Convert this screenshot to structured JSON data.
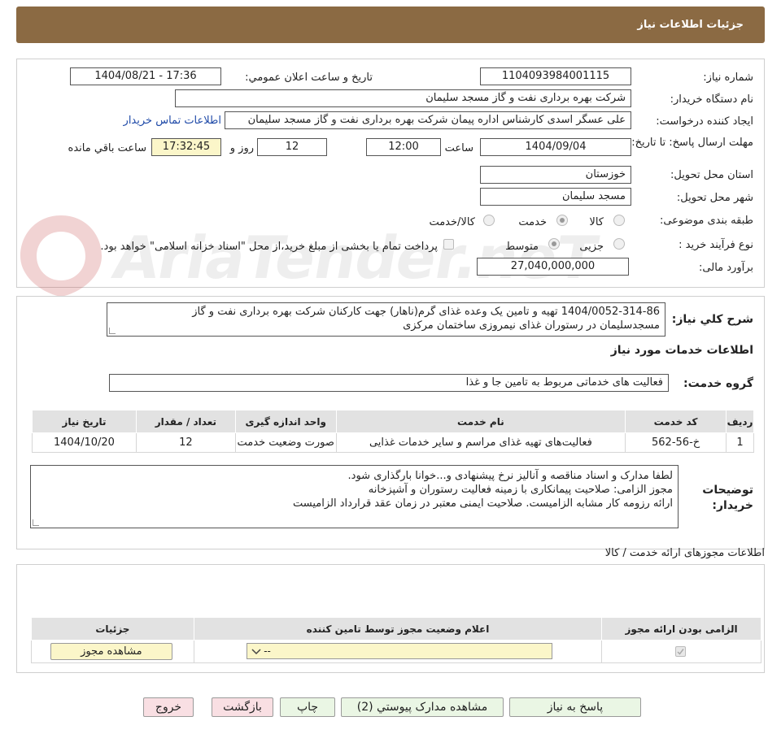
{
  "header": {
    "title": "جزئیات اطلاعات نیاز"
  },
  "form": {
    "need_number_label": "شماره نیاز:",
    "need_number": "1104093984001115",
    "announce_label": "تاریخ و ساعت اعلان عمومي:",
    "announce_value": "1404/08/21 - 17:36",
    "buyer_org_label": "نام دستگاه خريدار:",
    "buyer_org": "شرکت بهره برداری نفت و گاز مسجد سلیمان",
    "creator_label": "ایجاد کننده درخواست:",
    "creator": "علی عسگر اسدی کارشناس اداره پیمان  شرکت بهره برداری نفت و گاز مسجد سلیمان",
    "contact_link": "اطلاعات تماس خريدار",
    "deadline_label": "مهلت ارسال پاسخ: تا تاریخ:",
    "deadline_date": "1404/09/04",
    "time_label": "ساعت",
    "deadline_time": "12:00",
    "days_value": "12",
    "days_label": "روز و",
    "remaining_time": "17:32:45",
    "remaining_label": "ساعت باقي مانده",
    "province_label": "استان محل تحویل:",
    "province": "خوزستان",
    "city_label": "شهر محل تحویل:",
    "city": "مسجد سلیمان",
    "category_label": "طبقه بندی موضوعی:",
    "category_options": [
      "کالا",
      "خدمت",
      "کالا/خدمت"
    ],
    "category_selected": "خدمت",
    "process_label": "نوع فرآیند خرید :",
    "process_options": [
      "جزیی",
      "متوسط"
    ],
    "process_selected": "متوسط",
    "payment_note": "پرداخت تمام یا بخشی از مبلغ خرید،از محل \"اسناد خزانه اسلامی\" خواهد بود.",
    "budget_label": "برآورد مالی:",
    "budget": "27,040,000,000"
  },
  "description": {
    "label": "شرح کلي نياز:",
    "text_line1": "1404/0052-314-86  تهیه و تامین یک وعده غذای گرم(ناهار) جهت کارکنان شرکت بهره برداری نفت و گاز",
    "text_line2": "مسجدسلیمان در رستوران غذای نیمروزی ساختمان مرکزی",
    "services_title": "اطلاعات خدمات مورد نیاز",
    "service_group_label": "گروه خدمت:",
    "service_group": "فعالیت های خدماتی مربوط به تامین جا و غذا"
  },
  "services_table": {
    "headers": [
      "ردیف",
      "کد خدمت",
      "نام خدمت",
      "واحد اندازه گیری",
      "تعداد / مقدار",
      "تاریخ نیاز"
    ],
    "rows": [
      [
        "1",
        "خ-56-562",
        "فعالیت‌های تهیه غذای مراسم و سایر خدمات غذایی",
        "صورت وضعیت خدمت",
        "12",
        "1404/10/20"
      ]
    ]
  },
  "buyer_notes": {
    "label": "توضیحات خریدار:",
    "line1": "لطفا مدارک و اسناد مناقصه و آنالیز نرخ پیشنهادی و...خوانا بارگذاری شود.",
    "line2": "مجوز الزامی: صلاحیت پیمانکاری با زمینه فعالیت رستوران و آشپزخانه",
    "line3": "ارائه رزومه کار مشابه الزامیست. صلاحیت ایمنی معتبر در زمان عقد قرارداد الزامیست"
  },
  "permits": {
    "title": "اطلاعات مجوزهای ارائه خدمت / کالا",
    "headers": [
      "الزامی بودن ارائه مجوز",
      "اعلام وضعیت مجوز توسط تامین کننده",
      "جزئیات"
    ],
    "select_value": "--",
    "view_button": "مشاهده مجوز"
  },
  "buttons": {
    "reply": "پاسخ به نیاز",
    "attachments": "مشاهده مدارک پیوستي (2)",
    "print": "چاپ",
    "back": "بازگشت",
    "exit": "خروج"
  },
  "watermark": "AriaTender.neT"
}
